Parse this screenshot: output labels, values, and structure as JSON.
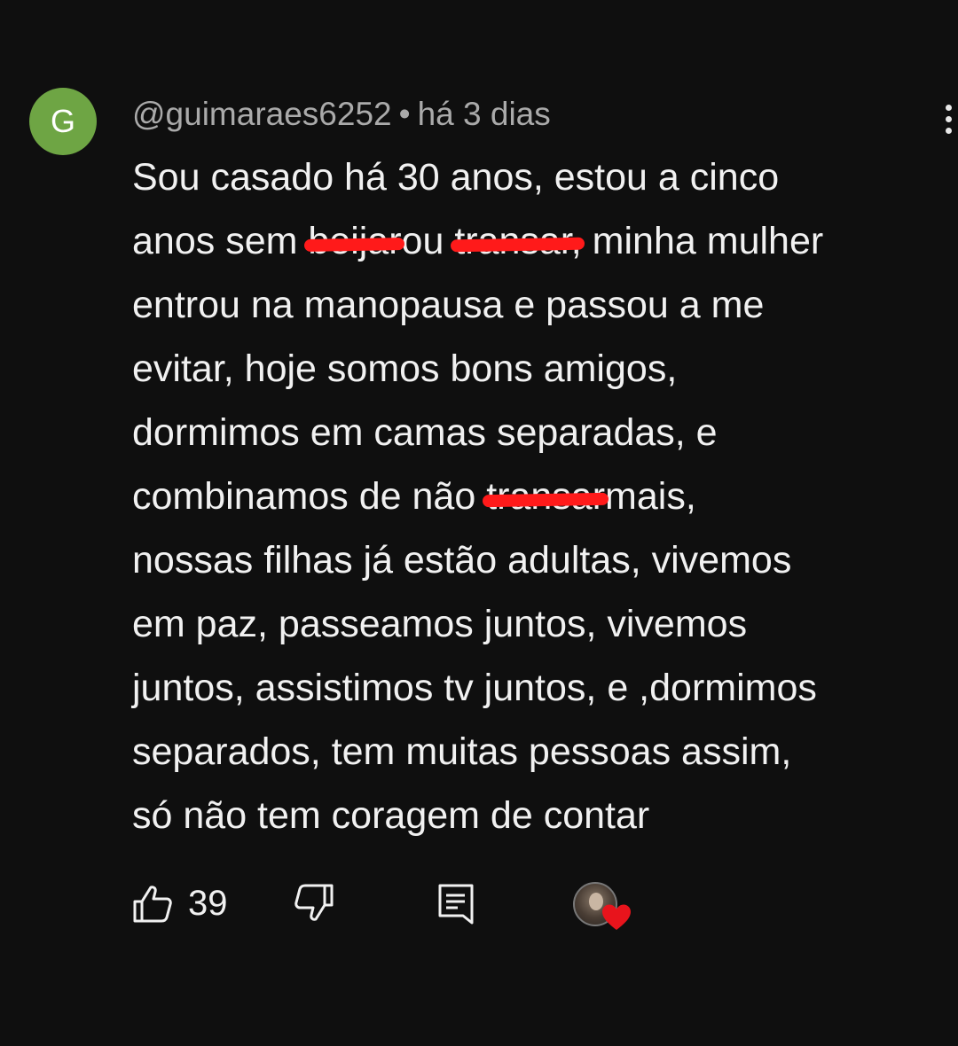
{
  "comment": {
    "author": {
      "initial": "G",
      "avatar_color": "#6ea544",
      "handle": "@guimaraes6252",
      "separator": "•",
      "time": "há 3 dias"
    },
    "lines": [
      [
        "Sou casado há 30 anos,  estou a cinco"
      ],
      [
        "anos sem ",
        {
          "redacted": "beijar"
        },
        "ou ",
        {
          "redacted": "transar,"
        },
        "  minha mulher"
      ],
      [
        "entrou na manopausa e passou a me"
      ],
      [
        "evitar,  hoje somos bons amigos,"
      ],
      [
        "dormimos em camas separadas,  e"
      ],
      [
        "combinamos de não ",
        {
          "redacted": "transar"
        },
        "mais,"
      ],
      [
        "nossas filhas já estão adultas,  vivemos"
      ],
      [
        "em paz, passeamos juntos,  vivemos"
      ],
      [
        "juntos, assistimos tv juntos,  e ,dormimos"
      ],
      [
        "separados,  tem muitas pessoas assim,"
      ],
      [
        "só não tem coragem de contar"
      ]
    ],
    "redaction_color": "#ff1a1a",
    "actions": {
      "like_icon": "thumbs-up-icon",
      "like_count": "39",
      "dislike_icon": "thumbs-down-icon",
      "reply_icon": "reply-comment-icon",
      "creator_heart_icon": "creator-heart-icon",
      "heart_color": "#e8141c"
    },
    "menu_icon": "more-vert-icon"
  }
}
